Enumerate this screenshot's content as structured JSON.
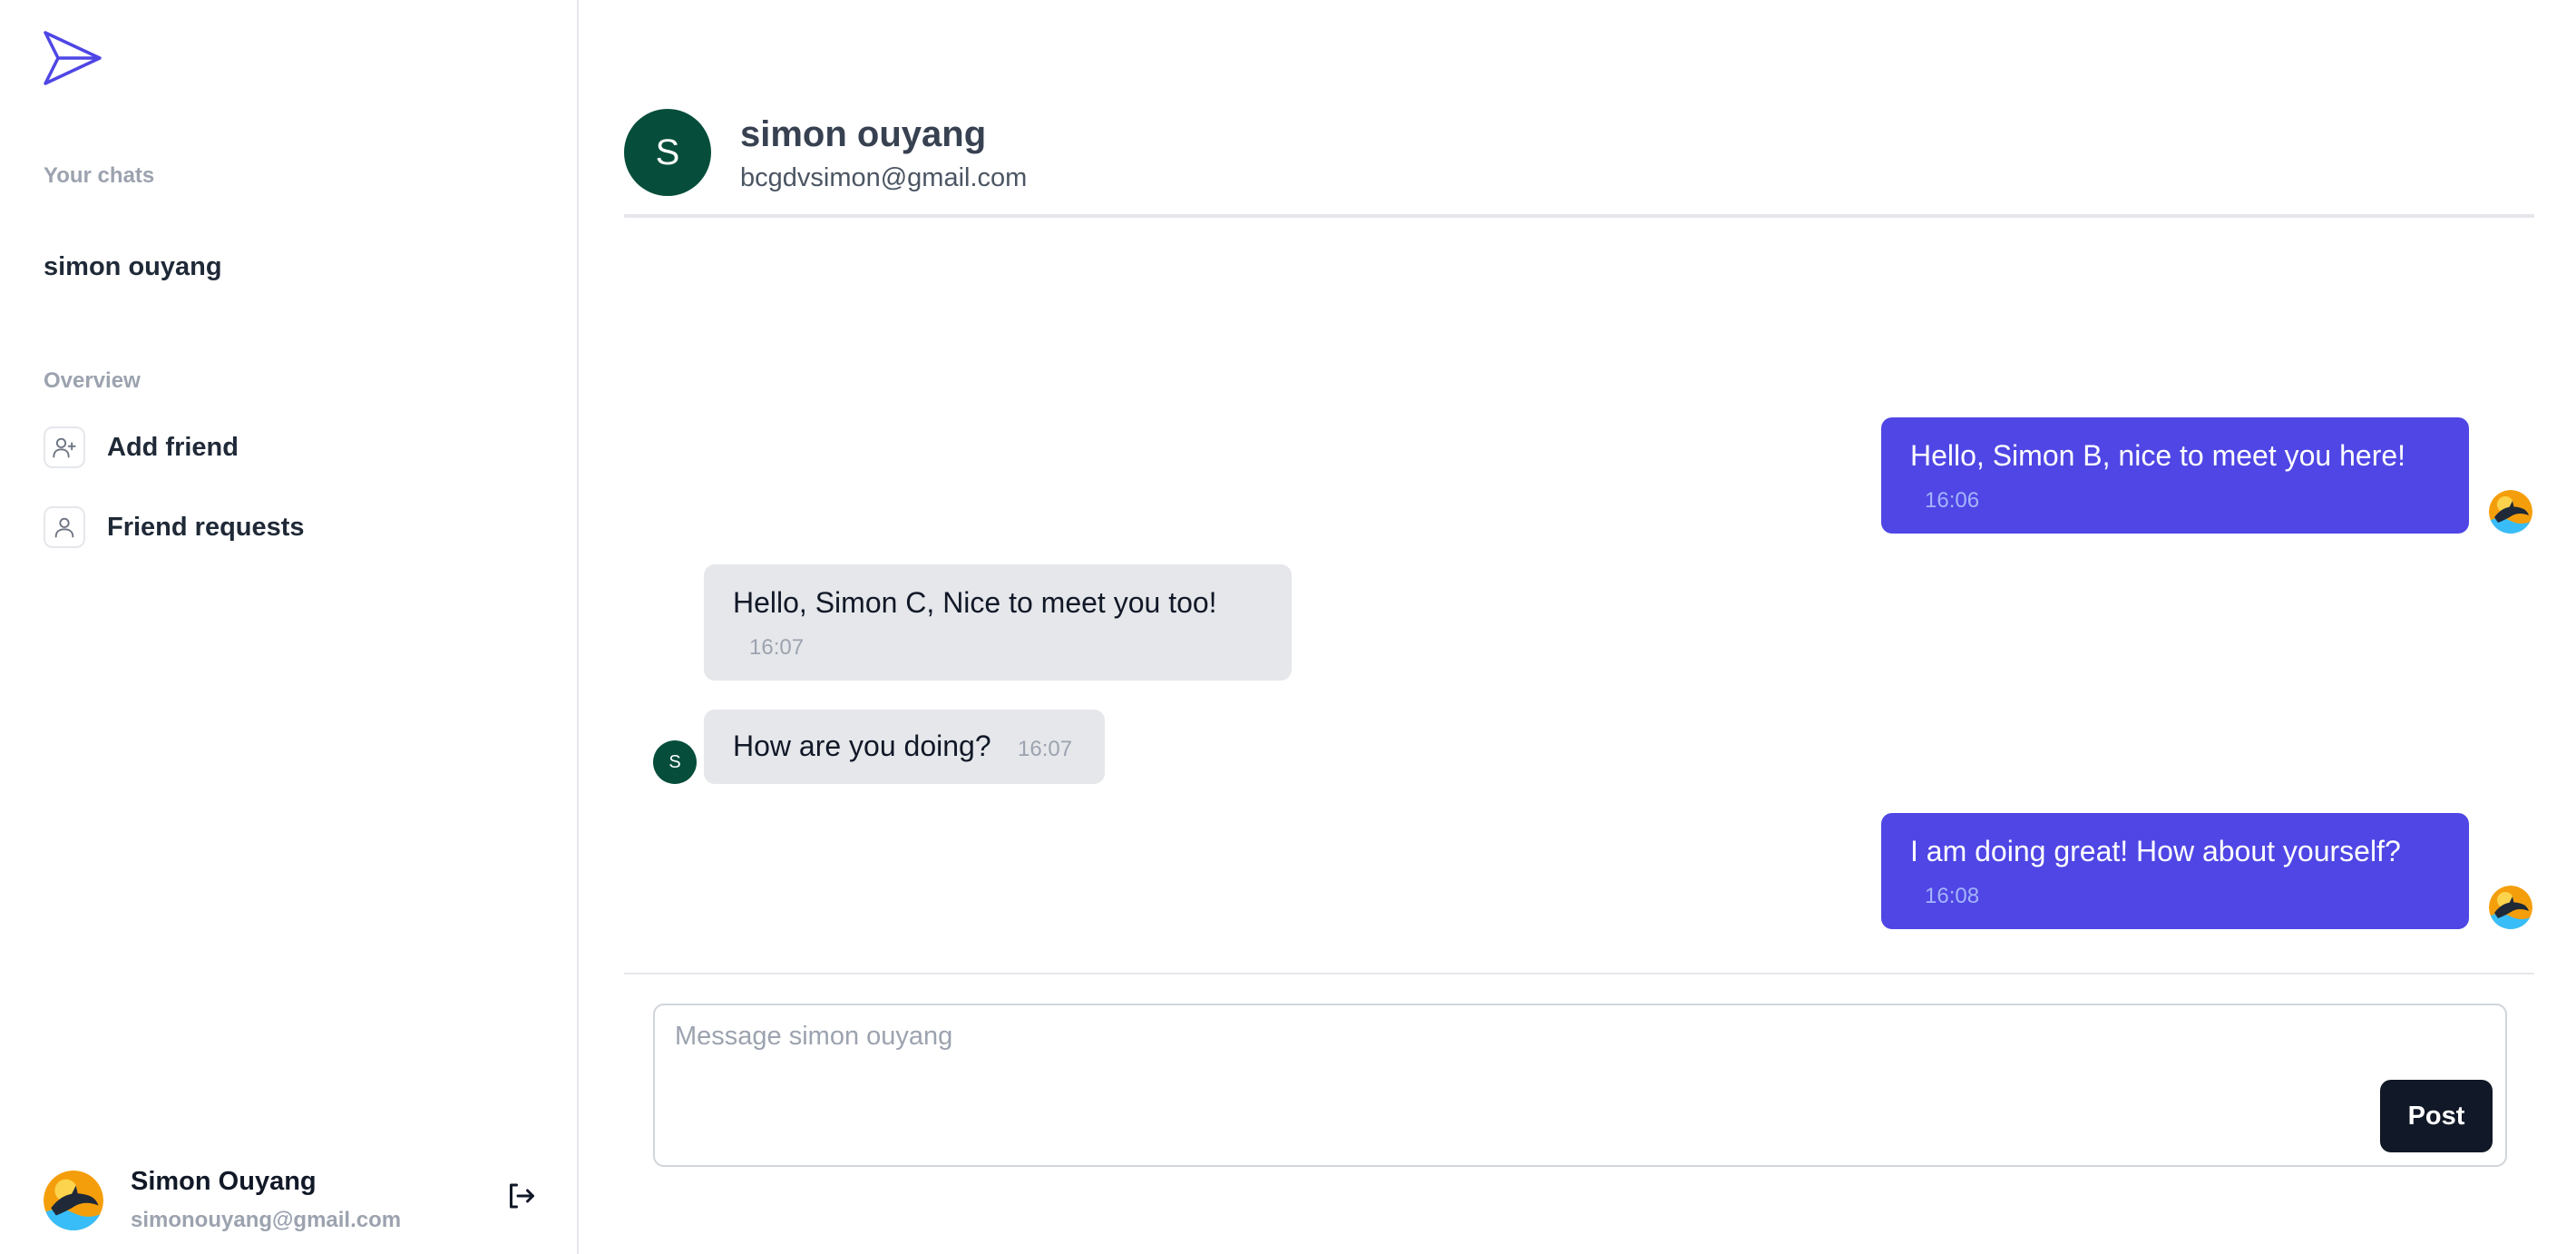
{
  "sidebar": {
    "your_chats_label": "Your chats",
    "chats": [
      {
        "name": "simon ouyang"
      }
    ],
    "overview_label": "Overview",
    "nav": [
      {
        "label": "Add friend",
        "icon": "user-plus-icon"
      },
      {
        "label": "Friend requests",
        "icon": "user-icon"
      }
    ],
    "profile": {
      "name": "Simon Ouyang",
      "email": "simonouyang@gmail.com"
    }
  },
  "chat": {
    "partner": {
      "name": "simon ouyang",
      "email": "bcgdvsimon@gmail.com",
      "initial": "S"
    },
    "messages": [
      {
        "text": "Hello, Simon B, nice to meet you here!",
        "time": "16:06",
        "from": "me"
      },
      {
        "text": "Hello, Simon C, Nice to meet you too!",
        "time": "16:07",
        "from": "partner"
      },
      {
        "text": "How are you doing?",
        "time": "16:07",
        "from": "partner"
      },
      {
        "text": "I am doing great! How about yourself?",
        "time": "16:08",
        "from": "me"
      }
    ]
  },
  "composer": {
    "placeholder": "Message simon ouyang",
    "post_label": "Post"
  },
  "colors": {
    "accent": "#4f46e5",
    "partner_avatar": "#064e3b",
    "incoming_bubble": "#e5e7eb",
    "button_dark": "#111827"
  }
}
